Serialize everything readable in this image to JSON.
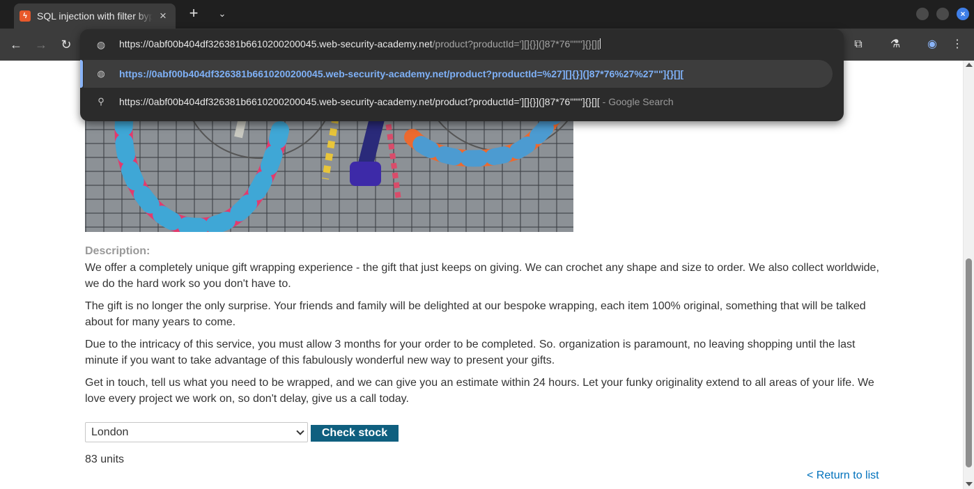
{
  "tab": {
    "title": "SQL injection with filter bypass via XML encoding",
    "favicon": "bolt-favicon-icon",
    "close": "×"
  },
  "tabstrip": {
    "new_tab": "+",
    "tab_search": "⌄"
  },
  "window": {
    "close": "×"
  },
  "toolbar": {
    "back": "←",
    "forward": "→",
    "reload": "↻",
    "extensions": "⧉",
    "labs": "⚗",
    "profile": "◉",
    "menu": "⋮"
  },
  "omnibox": {
    "input_host": "https://0abf00b404df326381b6610200200045.web-security-academy.net",
    "input_path": "/product?productId='][]{}](]87*76'\"\"\"]{}[][",
    "suggestions": [
      {
        "icon": "globe-icon",
        "text": "https://0abf00b404df326381b6610200200045.web-security-academy.net/product?productId=%27][]{}](]87*76%27%27\"\"]{}[][",
        "suffix": ""
      },
      {
        "icon": "search-icon",
        "text": "https://0abf00b404df326381b6610200200045.web-security-academy.net/product?productId='][]{}](]87*76'\"\"\"]{}[][",
        "suffix": " - Google Search"
      }
    ]
  },
  "page": {
    "description_label": "Description:",
    "paragraphs": [
      "We offer a completely unique gift wrapping experience - the gift that just keeps on giving. We can crochet any shape and size to order. We also collect worldwide, we do the hard work so you don't have to.",
      "The gift is no longer the only surprise. Your friends and family will be delighted at our bespoke wrapping, each item 100% original, something that will be talked about for many years to come.",
      "Due to the intricacy of this service, you must allow 3 months for your order to be completed. So. organization is paramount, no leaving shopping until the last minute if you want to take advantage of this fabulously wonderful new way to present your gifts.",
      "Get in touch, tell us what you need to be wrapped, and we can give you an estimate within 24 hours. Let your funky originality extend to all areas of your life. We love every project we work on, so don't delay, give us a call today."
    ],
    "stock_location": "London",
    "check_stock_label": "Check stock",
    "stock_result": "83 units",
    "return_link": "< Return to list"
  },
  "colors": {
    "button": "#0f5f7f",
    "link": "#0071bc",
    "omnibox_link": "#7fb1f7"
  }
}
